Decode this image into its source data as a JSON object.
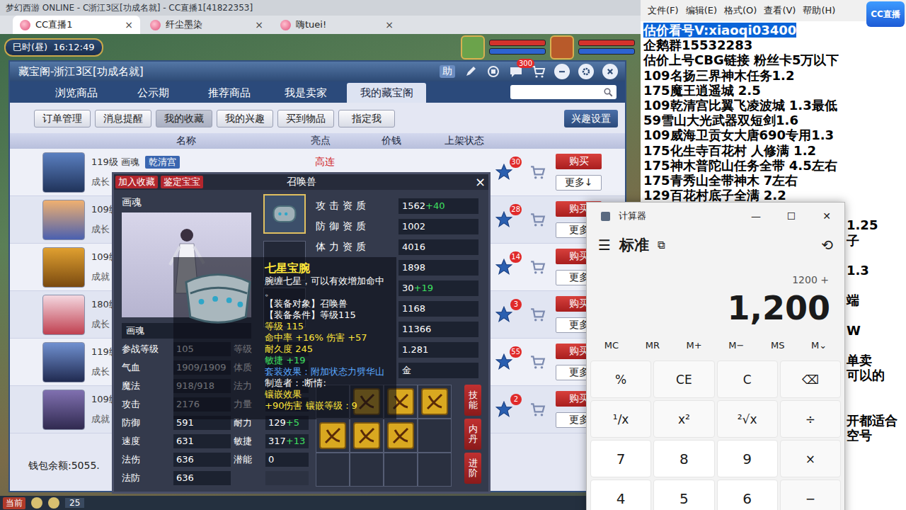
{
  "browser": {
    "title": "梦幻西游 ONLINE - C浙江3区[功成名就] - CC直播1[41822353]",
    "tabs": [
      {
        "label": "CC直播1",
        "selected": true,
        "close": "×"
      },
      {
        "label": "纤尘墨染",
        "selected": false,
        "close": "×"
      },
      {
        "label": "嗨tuei!",
        "selected": false,
        "close": "×"
      }
    ]
  },
  "hud": {
    "period": "巳时(昼)",
    "clock": "16:12:49"
  },
  "cbg": {
    "title": "藏宝阁-浙江3区[功成名就]",
    "help": "助",
    "chat_badge": "300",
    "tabs": [
      {
        "label": "浏览商品",
        "selected": false
      },
      {
        "label": "公示期",
        "selected": false
      },
      {
        "label": "推荐商品",
        "selected": false
      },
      {
        "label": "我是卖家",
        "selected": false
      },
      {
        "label": "我的藏宝阁",
        "selected": true
      }
    ],
    "subtabs": [
      {
        "label": "订单管理",
        "selected": false
      },
      {
        "label": "消息提醒",
        "selected": false
      },
      {
        "label": "我的收藏",
        "selected": true
      },
      {
        "label": "我的兴趣",
        "selected": false
      },
      {
        "label": "买到物品",
        "selected": false
      },
      {
        "label": "指定我",
        "selected": false
      }
    ],
    "interest_button": "兴趣设置",
    "columns": [
      "名称",
      "亮点",
      "价钱",
      "上架状态"
    ],
    "rows": [
      {
        "level_name": "119级 画魂",
        "school": "乾清宫",
        "growth": "成长",
        "highlight": "高连",
        "stars": "30",
        "buy": "购买",
        "more": "更多↓"
      },
      {
        "level_name": "109级",
        "growth": "成长",
        "stars": "28",
        "buy": "购买",
        "more": "更多"
      },
      {
        "level_name": "109级",
        "growth": "成就",
        "stars": "14",
        "buy": "购买",
        "more": "更多"
      },
      {
        "level_name": "180级",
        "growth": "成长",
        "stars": "3",
        "buy": "购买",
        "more": "更多"
      },
      {
        "level_name": "119级",
        "growth": "成长",
        "stars": "55",
        "buy": "购买",
        "more": "更多"
      },
      {
        "level_name": "109级",
        "growth": "成就",
        "stars": "2",
        "buy": "购买",
        "more": "更多"
      }
    ],
    "wallet": "钱包余额:5055."
  },
  "pet": {
    "title": "召唤兽",
    "close": "×",
    "actions": [
      "加入收藏",
      "鉴定宝宝"
    ],
    "name": "画魂",
    "name_field": "画魂",
    "stats": [
      {
        "l": "参战等级",
        "v": "105",
        "l2": "等级",
        "v2": "",
        "b2": ""
      },
      {
        "l": "气血",
        "v": "1909/1909",
        "l2": "体质",
        "v2": "",
        "b2": ""
      },
      {
        "l": "魔法",
        "v": "918/918",
        "l2": "法力",
        "v2": "",
        "b2": ""
      },
      {
        "l": "攻击",
        "v": "2176",
        "l2": "力量",
        "v2": "",
        "b2": ""
      },
      {
        "l": "防御",
        "v": "591",
        "l2": "耐力",
        "v2": "129",
        "b2": "+5"
      },
      {
        "l": "速度",
        "v": "631",
        "l2": "敏捷",
        "v2": "317",
        "b2": "+13"
      },
      {
        "l": "法伤",
        "v": "636",
        "l2": "潜能",
        "v2": "0",
        "b2": ""
      },
      {
        "l": "法防",
        "v": "636",
        "l2": "",
        "v2": "",
        "b2": ""
      }
    ],
    "aptitudes": [
      {
        "label": "攻击资质",
        "value": "1562",
        "bonus": "+40"
      },
      {
        "label": "防御资质",
        "value": "1002",
        "bonus": ""
      },
      {
        "label": "体力资质",
        "value": "4016",
        "bonus": ""
      },
      {
        "label": "",
        "value": "1898",
        "bonus": ""
      },
      {
        "label": "",
        "value": "30",
        "bonus": "+19"
      },
      {
        "label": "",
        "value": "1168",
        "bonus": ""
      },
      {
        "label": "",
        "value": "11366",
        "bonus": ""
      },
      {
        "label": "",
        "value": "1.281",
        "bonus": ""
      },
      {
        "label": "",
        "value": "金",
        "bonus": ""
      }
    ],
    "skill_slots": [
      {
        "filled": false
      },
      {
        "filled": true
      },
      {
        "filled": true
      },
      {
        "filled": true
      },
      {
        "filled": true
      },
      {
        "filled": true
      },
      {
        "filled": true
      },
      {
        "filled": false
      },
      {
        "filled": false
      },
      {
        "filled": false
      },
      {
        "filled": false
      },
      {
        "filled": false
      }
    ],
    "side_buttons": [
      "技能",
      "内丹",
      "进阶"
    ]
  },
  "tooltip": {
    "title": "七星宝腕",
    "lines": [
      {
        "text": "腕缠七星，可以有效增加命中",
        "kind": "desc"
      },
      {
        "text": "。",
        "kind": "desc"
      },
      {
        "text": "【装备对象】召唤兽",
        "kind": "desc"
      },
      {
        "text": "【装备条件】等级115",
        "kind": "desc"
      },
      {
        "text": "等级 115",
        "kind": "attr"
      },
      {
        "text": "命中率 +16% 伤害 +57",
        "kind": "attr"
      },
      {
        "text": "耐久度 245",
        "kind": "attr"
      },
      {
        "text": "敏捷 +19",
        "kind": "bonus"
      },
      {
        "text": "套装效果：附加状态力劈华山",
        "kind": "set"
      },
      {
        "text": "制造者：:断情:",
        "kind": "desc"
      },
      {
        "text": "镶嵌效果",
        "kind": "attr"
      },
      {
        "text": "+90伤害 镶嵌等级：9",
        "kind": "attr"
      }
    ]
  },
  "game_bar": {
    "button": "当前",
    "count": "25"
  },
  "notepad": {
    "menu": [
      "文件(F)",
      "编辑(E)",
      "格式(O)",
      "查看(V)",
      "帮助(H)"
    ],
    "logo": "CC直播",
    "lines": [
      {
        "text": "估价看号V:xiaoqi03400",
        "kind": "full",
        "selected": true
      },
      {
        "text": "企鹅群15532283",
        "kind": "full",
        "selected": false
      },
      {
        "text": "估价上号CBG链接 粉丝卡5万以下",
        "kind": "full",
        "selected": false
      },
      {
        "text": "109名扬三界神木任务1.2",
        "kind": "full",
        "selected": false
      },
      {
        "text": "175魔王逍遥城 2.5",
        "kind": "full",
        "selected": false
      },
      {
        "text": "109乾清宫比翼飞凌波城 1.3最低",
        "kind": "full",
        "selected": false
      },
      {
        "text": "59雪山大光武器双短剑1.6",
        "kind": "full",
        "selected": false
      },
      {
        "text": "109威海卫贡女大唐690专用1.3",
        "kind": "full",
        "selected": false
      },
      {
        "text": "175化生寺百花村 人修满 1.2",
        "kind": "full",
        "selected": false
      },
      {
        "text": "175神木普陀山任务全带 4.5左右",
        "kind": "full",
        "selected": false
      },
      {
        "text": "175青秀山全带神木  7左右",
        "kind": "full",
        "selected": false
      },
      {
        "text": "129百花村底子全满 2.2",
        "kind": "full",
        "selected": false
      },
      {
        "text": "",
        "kind": "tail",
        "selected": false
      },
      {
        "text": "1.25",
        "kind": "tail",
        "selected": false
      },
      {
        "text": "子",
        "kind": "tail",
        "selected": false
      },
      {
        "text": "",
        "kind": "tail",
        "selected": false
      },
      {
        "text": "1.3",
        "kind": "tail",
        "selected": false
      },
      {
        "text": "",
        "kind": "tail",
        "selected": false
      },
      {
        "text": "端",
        "kind": "tail",
        "selected": false
      },
      {
        "text": "",
        "kind": "tail",
        "selected": false
      },
      {
        "text": "W",
        "kind": "tail",
        "selected": false
      },
      {
        "text": "",
        "kind": "tail",
        "selected": false
      },
      {
        "text": "单卖",
        "kind": "tail",
        "selected": false
      },
      {
        "text": "可以的",
        "kind": "tail",
        "selected": false
      },
      {
        "text": "",
        "kind": "tail",
        "selected": false
      },
      {
        "text": "",
        "kind": "tail",
        "selected": false
      },
      {
        "text": "开都适合",
        "kind": "tail",
        "selected": false
      },
      {
        "text": "空号",
        "kind": "tail",
        "selected": false
      }
    ]
  },
  "calculator": {
    "title": "计算器",
    "controls": [
      "—",
      "☐",
      "✕"
    ],
    "menu_icon": "☰",
    "mode": "标准",
    "keep_on_top": "⧉",
    "history_icon": "⟲",
    "expression": "1200 +",
    "display": "1,200",
    "memory": [
      "MC",
      "MR",
      "M+",
      "M−",
      "MS",
      "M⌄"
    ],
    "keys": [
      {
        "label": "%",
        "kind": "func"
      },
      {
        "label": "CE",
        "kind": "func"
      },
      {
        "label": "C",
        "kind": "func"
      },
      {
        "label": "⌫",
        "kind": "func"
      },
      {
        "label": "¹/x",
        "kind": "func"
      },
      {
        "label": "x²",
        "kind": "func"
      },
      {
        "label": "²√x",
        "kind": "func"
      },
      {
        "label": "÷",
        "kind": "func"
      },
      {
        "label": "7",
        "kind": "digit"
      },
      {
        "label": "8",
        "kind": "digit"
      },
      {
        "label": "9",
        "kind": "digit"
      },
      {
        "label": "×",
        "kind": "func"
      },
      {
        "label": "4",
        "kind": "digit"
      },
      {
        "label": "5",
        "kind": "digit"
      },
      {
        "label": "6",
        "kind": "digit"
      },
      {
        "label": "−",
        "kind": "func"
      }
    ]
  }
}
